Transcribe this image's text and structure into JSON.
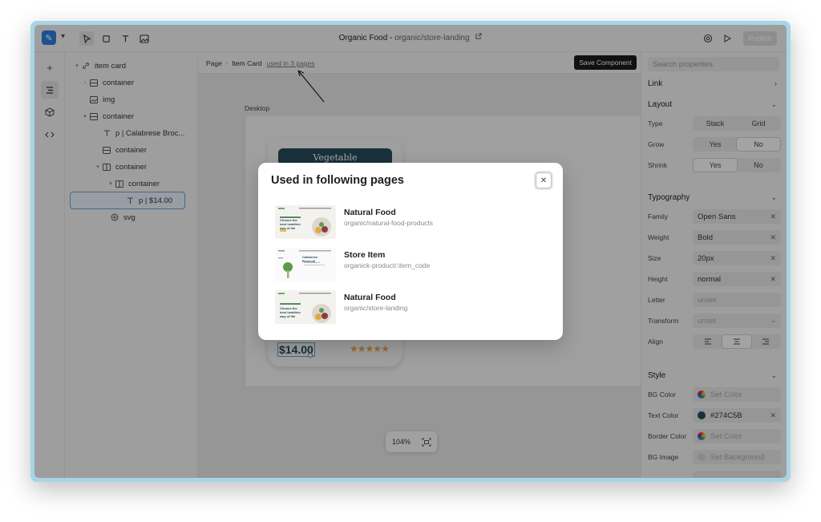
{
  "window": {
    "title": "Organic Food",
    "title_sep": " - ",
    "path": "organic/store-landing",
    "publish_label": "Publish"
  },
  "layers": [
    {
      "label": "item card",
      "icon": "link-icon",
      "chev": "open"
    },
    {
      "label": "container",
      "icon": "container-icon",
      "chev": "closed"
    },
    {
      "label": "img",
      "icon": "image-icon",
      "chev": ""
    },
    {
      "label": "container",
      "icon": "container-icon",
      "chev": "open"
    },
    {
      "label": "p | Calabrese Broc...",
      "icon": "text-icon",
      "chev": ""
    },
    {
      "label": "container",
      "icon": "container-icon",
      "chev": ""
    },
    {
      "label": "container",
      "icon": "columns-icon",
      "chev": "open"
    },
    {
      "label": "container",
      "icon": "columns-icon",
      "chev": "open"
    },
    {
      "label": "p | $14.00",
      "icon": "text-icon",
      "chev": "",
      "selected": true
    },
    {
      "label": "svg",
      "icon": "svg-icon",
      "chev": ""
    }
  ],
  "canvas": {
    "breadcrumb": [
      "Page",
      "Item Card"
    ],
    "used_in": "used in 3 pages",
    "save_component": "Save Component",
    "frame_label": "Desktop",
    "card": {
      "tag": "Vegetable",
      "price": "$14.00",
      "rating": 5
    },
    "zoom": "104%"
  },
  "properties": {
    "search_placeholder": "Search properties",
    "link_header": "Link",
    "layout_header": "Layout",
    "type_label": "Type",
    "type_options": [
      "Stack",
      "Grid"
    ],
    "grow_label": "Grow",
    "grow_options": [
      "Yes",
      "No"
    ],
    "shrink_label": "Shrink",
    "shrink_options": [
      "Yes",
      "No"
    ],
    "typography_header": "Typography",
    "family_label": "Family",
    "family_value": "Open Sans",
    "weight_label": "Weight",
    "weight_value": "Bold",
    "size_label": "Size",
    "size_value": "20px",
    "height_label": "Height",
    "height_value": "normal",
    "letter_label": "Letter",
    "letter_value": "unset",
    "transform_label": "Transform",
    "transform_value": "unset",
    "align_label": "Align",
    "style_header": "Style",
    "bg_color_label": "BG Color",
    "bg_color_value": "Set Color",
    "text_color_label": "Text Color",
    "text_color_value": "#274C5B",
    "border_color_label": "Border Color",
    "border_color_value": "Set Color",
    "bg_image_label": "BG Image",
    "bg_image_value": "Set Background"
  },
  "modal": {
    "title": "Used in following pages",
    "pages": [
      {
        "name": "Natural Food",
        "path": "organic/natural-food-products"
      },
      {
        "name": "Store Item",
        "path": "organick-product/:item_code"
      },
      {
        "name": "Natural Food",
        "path": "organic/store-landing"
      }
    ],
    "thumb_text": [
      "Choose the best healthier way of life",
      "Calabrese Broccoli",
      "Choose the best healthier way of life"
    ]
  },
  "colors": {
    "brand": "#274C5B",
    "accent": "#2D7FE0",
    "stars": "#F0A447"
  }
}
